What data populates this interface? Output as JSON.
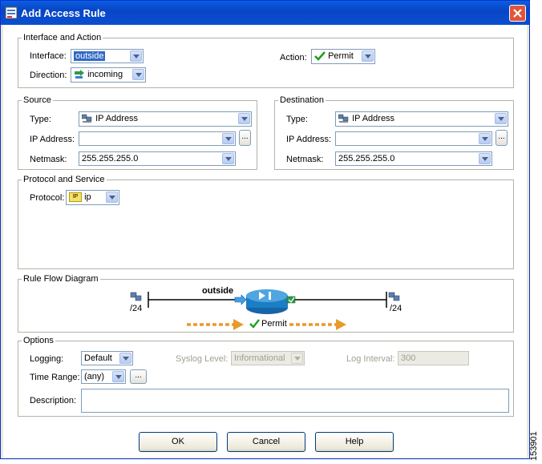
{
  "window": {
    "title": "Add Access Rule",
    "icon": "rule-icon",
    "close": "close-icon"
  },
  "interface_action": {
    "legend": "Interface and Action",
    "interface_label": "Interface:",
    "interface_value": "outside",
    "direction_label": "Direction:",
    "direction_value": "incoming",
    "action_label": "Action:",
    "action_value": "Permit"
  },
  "source": {
    "legend": "Source",
    "type_label": "Type:",
    "type_value": "IP Address",
    "ip_label": "IP Address:",
    "ip_value": "",
    "netmask_label": "Netmask:",
    "netmask_value": "255.255.255.0",
    "ellipsis": "..."
  },
  "destination": {
    "legend": "Destination",
    "type_label": "Type:",
    "type_value": "IP Address",
    "ip_label": "IP Address:",
    "ip_value": "",
    "netmask_label": "Netmask:",
    "netmask_value": "255.255.255.0",
    "ellipsis": "..."
  },
  "protocol_service": {
    "legend": "Protocol and Service",
    "protocol_label": "Protocol:",
    "protocol_value": "ip",
    "protocol_icon_text": "IP"
  },
  "rule_flow": {
    "legend": "Rule Flow Diagram",
    "left_prefix": "/24",
    "right_prefix": "/24",
    "interface_name": "outside",
    "action_text": "Permit"
  },
  "options": {
    "legend": "Options",
    "logging_label": "Logging:",
    "logging_value": "Default",
    "syslog_label": "Syslog Level:",
    "syslog_value": "Informational",
    "interval_label": "Log Interval:",
    "interval_value": "300",
    "time_range_label": "Time Range:",
    "time_range_value": "(any)",
    "time_range_ellipsis": "...",
    "description_label": "Description:",
    "description_value": ""
  },
  "buttons": {
    "ok": "OK",
    "cancel": "Cancel",
    "help": "Help"
  },
  "figure_id": "153901",
  "colors": {
    "titlebar": "#0845c6",
    "permit_green": "#1f9d1f",
    "arrow_orange": "#e89a2c",
    "router_blue": "#1c7ec4"
  }
}
